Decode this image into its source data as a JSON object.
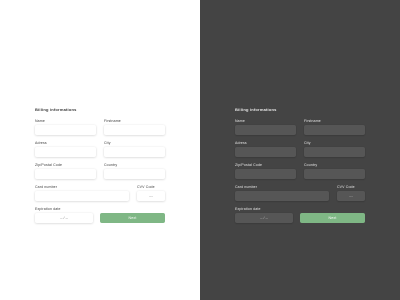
{
  "theme_colors": {
    "light_bg": "#ffffff",
    "dark_bg": "#444444",
    "accent": "#7fb785"
  },
  "form": {
    "title": "Billing informations",
    "name_label": "Name",
    "firstname_label": "Firstname",
    "address_label": "Adress",
    "city_label": "City",
    "zip_label": "Zip/Postal Code",
    "country_label": "Country",
    "card_label": "Card number",
    "cvv_label": "CVV Code",
    "cvv_placeholder": "---",
    "expiry_label": "Expiration date",
    "expiry_placeholder": "-- / --",
    "next_label": "Next"
  }
}
